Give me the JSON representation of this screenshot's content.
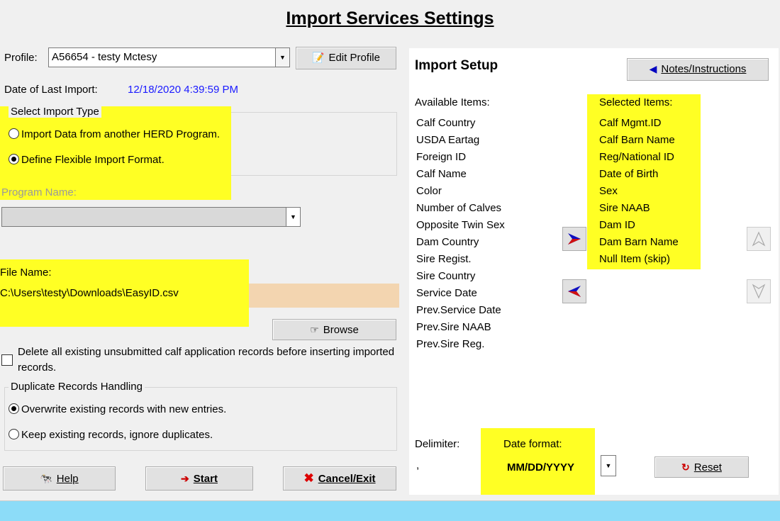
{
  "title": "Import Services Settings",
  "profile": {
    "label": "Profile:",
    "value": "A56654 - testy Mctesy",
    "edit_label": "Edit Profile"
  },
  "last_import": {
    "label": "Date of Last Import:",
    "value": "12/18/2020 4:39:59 PM"
  },
  "import_type": {
    "label": "Select Import Type",
    "options": [
      "Import Data from another HERD Program.",
      "Define Flexible Import Format."
    ],
    "selected": 1
  },
  "program_name": {
    "label": "Program Name:",
    "value": ""
  },
  "file": {
    "label": "File Name:",
    "value": "C:\\Users\\testy\\Downloads\\EasyID.csv",
    "browse_label": "Browse"
  },
  "delete_option": {
    "label": "Delete all existing unsubmitted calf application records before inserting imported records.",
    "checked": false
  },
  "duplicates": {
    "label": "Duplicate Records Handling",
    "options": [
      "Overwrite existing records with new entries.",
      "Keep existing records, ignore duplicates."
    ],
    "selected": 0
  },
  "buttons": {
    "help": "Help",
    "start": "Start",
    "cancel": "Cancel/Exit"
  },
  "import_setup": {
    "title": "Import Setup",
    "notes_label": "Notes/Instructions",
    "available_label": "Available Items:",
    "selected_label": "Selected Items:",
    "available_items": [
      "Calf Country",
      "USDA Eartag",
      "Foreign ID",
      "Calf Name",
      "Color",
      "Number of Calves",
      "Opposite Twin Sex",
      "Dam Country",
      "Sire Regist.",
      "Sire Country",
      "Service Date",
      "Prev.Service Date",
      "Prev.Sire NAAB",
      "Prev.Sire Reg."
    ],
    "selected_items": [
      "Calf Mgmt.ID",
      "Calf Barn Name",
      "Reg/National ID",
      "Date of Birth",
      "Sex",
      "Sire NAAB",
      "Dam ID",
      "Dam Barn Name",
      "Null Item (skip)"
    ],
    "delimiter_label": "Delimiter:",
    "delimiter_value": ",",
    "date_format_label": "Date format:",
    "date_format_value": "MM/DD/YYYY",
    "reset_label": "Reset"
  },
  "colors": {
    "highlight": "#ffff24",
    "link_blue": "#0000ff",
    "file_bg": "#f3d5b0",
    "footer": "#8cdcf8"
  },
  "icons": [
    "dropdown-arrow-icon",
    "edit-profile-icon",
    "left-arrow-icon",
    "right-arrow-icon",
    "up-arrow-icon",
    "down-arrow-icon",
    "browse-icon",
    "help-icon",
    "start-icon",
    "cancel-x-icon",
    "reset-icon"
  ]
}
